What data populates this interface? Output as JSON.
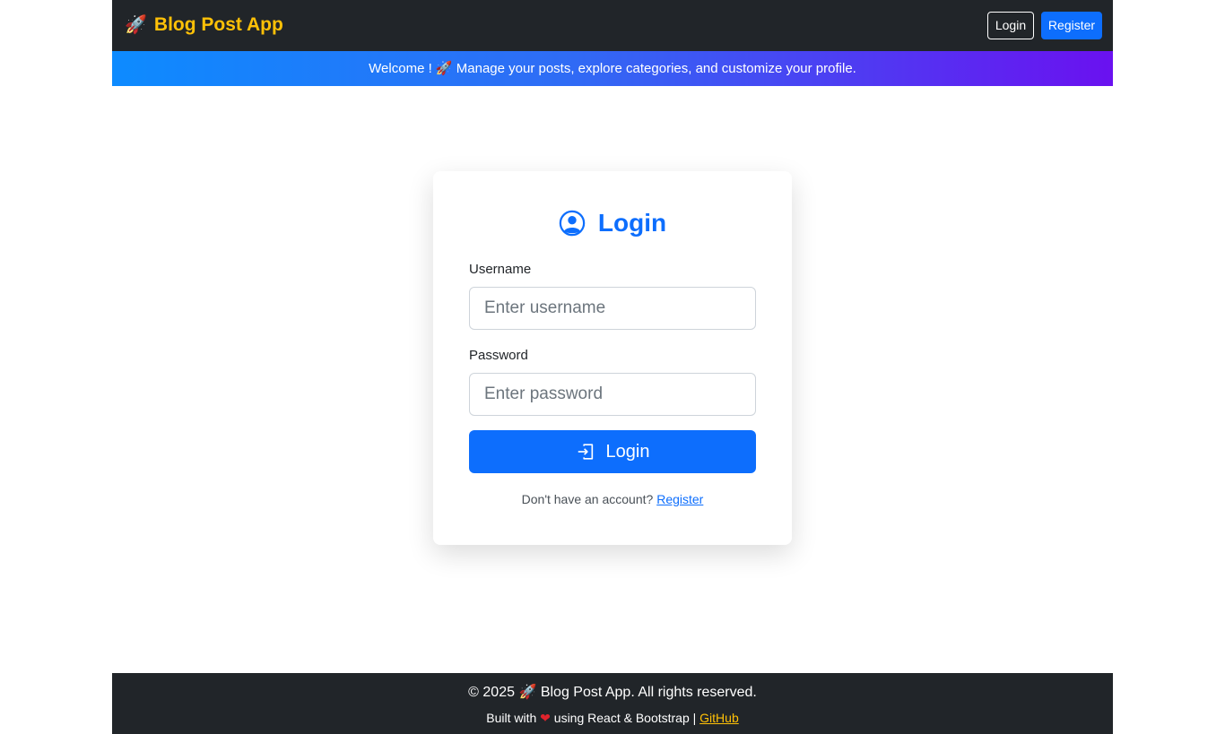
{
  "navbar": {
    "brand_icon": "🚀",
    "brand_text": "Blog Post App",
    "login_label": "Login",
    "register_label": "Register"
  },
  "banner": {
    "text": "Welcome ! 🚀 Manage your posts, explore categories, and customize your profile."
  },
  "login_card": {
    "title": "Login",
    "title_icon": "user-circle-icon",
    "username_label": "Username",
    "username_placeholder": "Enter username",
    "password_label": "Password",
    "password_placeholder": "Enter password",
    "submit_label": "Login",
    "submit_icon": "login-arrow-icon",
    "signup_prompt": "Don't have an account?",
    "signup_link": "Register"
  },
  "footer": {
    "copyright": "© 2025 🚀 Blog Post App. All rights reserved.",
    "built_with_prefix": "Built with",
    "heart_icon": "❤",
    "built_with_suffix": "using React & Bootstrap |",
    "github_link": "GitHub"
  },
  "colors": {
    "navbar_bg": "#212529",
    "brand": "#ffc107",
    "primary": "#0d6efd",
    "banner_start": "#0d8bff",
    "banner_end": "#6a11f0"
  }
}
